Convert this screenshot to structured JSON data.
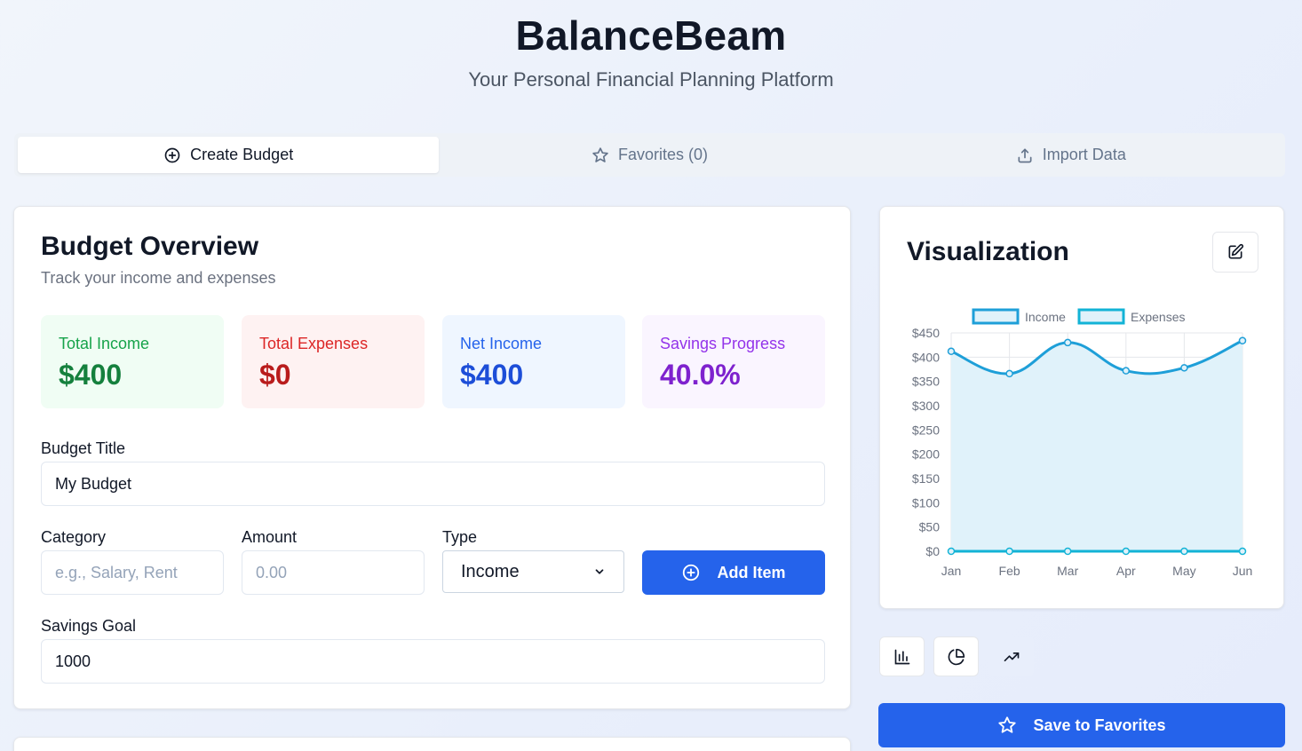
{
  "app": {
    "title": "BalanceBeam",
    "subtitle": "Your Personal Financial Planning Platform"
  },
  "tabs": [
    {
      "label": "Create Budget",
      "icon": "plus-circle-icon",
      "active": true
    },
    {
      "label": "Favorites (0)",
      "icon": "star-icon",
      "active": false
    },
    {
      "label": "Import Data",
      "icon": "upload-icon",
      "active": false
    }
  ],
  "overview": {
    "title": "Budget Overview",
    "subtitle": "Track your income and expenses",
    "stats": [
      {
        "label": "Total Income",
        "value": "$400"
      },
      {
        "label": "Total Expenses",
        "value": "$0"
      },
      {
        "label": "Net Income",
        "value": "$400"
      },
      {
        "label": "Savings Progress",
        "value": "40.0%"
      }
    ]
  },
  "form": {
    "budget_title_label": "Budget Title",
    "budget_title_value": "My Budget",
    "category_label": "Category",
    "category_placeholder": "e.g., Salary, Rent",
    "amount_label": "Amount",
    "amount_placeholder": "0.00",
    "type_label": "Type",
    "type_value": "Income",
    "add_button": "Add Item",
    "savings_goal_label": "Savings Goal",
    "savings_goal_value": "1000"
  },
  "visualization": {
    "title": "Visualization",
    "chart_types": [
      "bar-chart-icon",
      "pie-chart-icon",
      "trending-up-icon"
    ],
    "active_chart_type": "trending-up-icon",
    "save_button": "Save to Favorites"
  },
  "chart_data": {
    "type": "line",
    "categories": [
      "Jan",
      "Feb",
      "Mar",
      "Apr",
      "May",
      "Jun"
    ],
    "series": [
      {
        "name": "Income",
        "values": [
          412,
          366,
          430,
          372,
          378,
          434
        ],
        "color": "#1e9fd8",
        "fill": true
      },
      {
        "name": "Expenses",
        "values": [
          0,
          0,
          0,
          0,
          0,
          0
        ],
        "color": "#12b3d6",
        "fill": false
      }
    ],
    "ylim": [
      0,
      450
    ],
    "yticks": [
      "$0",
      "$50",
      "$100",
      "$150",
      "$200",
      "$250",
      "$300",
      "$350",
      "$400",
      "$450"
    ],
    "legend": "top",
    "grid": true
  },
  "colors": {
    "primary": "#2563eb",
    "income": "#15803d",
    "expenses": "#b91c1c",
    "net": "#1d4ed8",
    "savings": "#7e22ce"
  }
}
